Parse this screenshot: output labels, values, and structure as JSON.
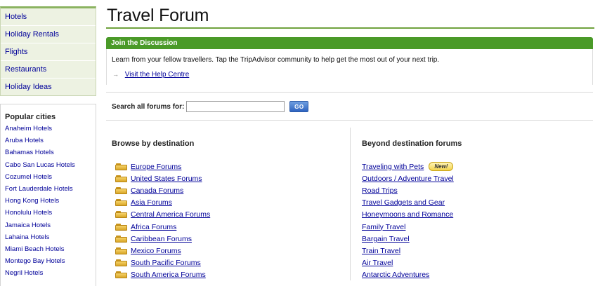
{
  "sidebar": {
    "nav": [
      "Hotels",
      "Holiday Rentals",
      "Flights",
      "Restaurants",
      "Holiday Ideas"
    ],
    "popular_title": "Popular cities",
    "cities": [
      "Anaheim Hotels",
      "Aruba Hotels",
      "Bahamas Hotels",
      "Cabo San Lucas Hotels",
      "Cozumel Hotels",
      "Fort Lauderdale Hotels",
      "Hong Kong Hotels",
      "Honolulu Hotels",
      "Jamaica Hotels",
      "Lahaina Hotels",
      "Miami Beach Hotels",
      "Montego Bay Hotels",
      "Negril Hotels"
    ]
  },
  "page_title": "Travel Forum",
  "discussion": {
    "header": "Join the Discussion",
    "text": "Learn from your fellow travellers. Tap the TripAdvisor community to help get the most out of your next trip.",
    "help_arrow": "→",
    "help_link": "Visit the Help Centre"
  },
  "search": {
    "label": "Search all forums for:",
    "value": "",
    "button": "GO"
  },
  "browse": {
    "heading": "Browse by destination",
    "items": [
      "Europe Forums",
      "United States Forums",
      "Canada Forums",
      "Asia Forums",
      "Central America Forums",
      "Africa Forums",
      "Caribbean Forums",
      "Mexico Forums",
      "South Pacific Forums",
      "South America Forums"
    ]
  },
  "beyond": {
    "heading": "Beyond destination forums",
    "new_badge": "New!",
    "items": [
      "Traveling with Pets",
      "Outdoors / Adventure Travel",
      "Road Trips",
      "Travel Gadgets and Gear",
      "Honeymoons and Romance",
      "Family Travel",
      "Bargain Travel",
      "Train Travel",
      "Air Travel",
      "Antarctic Adventures"
    ]
  }
}
